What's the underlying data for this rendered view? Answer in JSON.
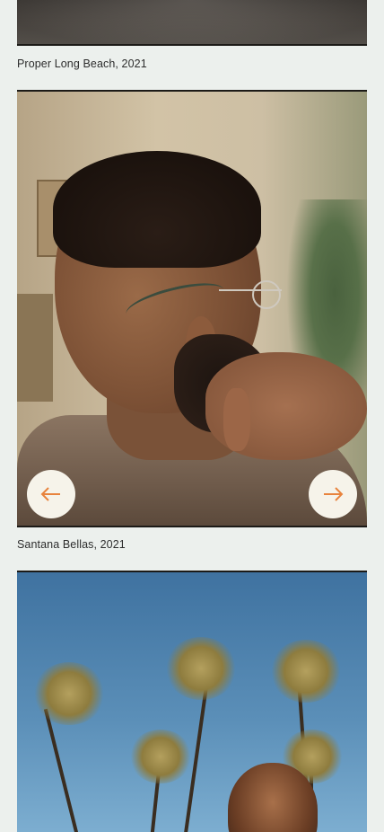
{
  "gallery": {
    "items": [
      {
        "caption": "Proper Long Beach, 2021"
      },
      {
        "caption": "Santana Bellas, 2021"
      },
      {
        "caption": ""
      }
    ]
  },
  "carousel": {
    "prev_icon": "arrow-left-icon",
    "next_icon": "arrow-right-icon"
  },
  "colors": {
    "background": "#ecf0ed",
    "arrow_accent": "#e8833d",
    "button_fill": "#f6f3ea"
  }
}
